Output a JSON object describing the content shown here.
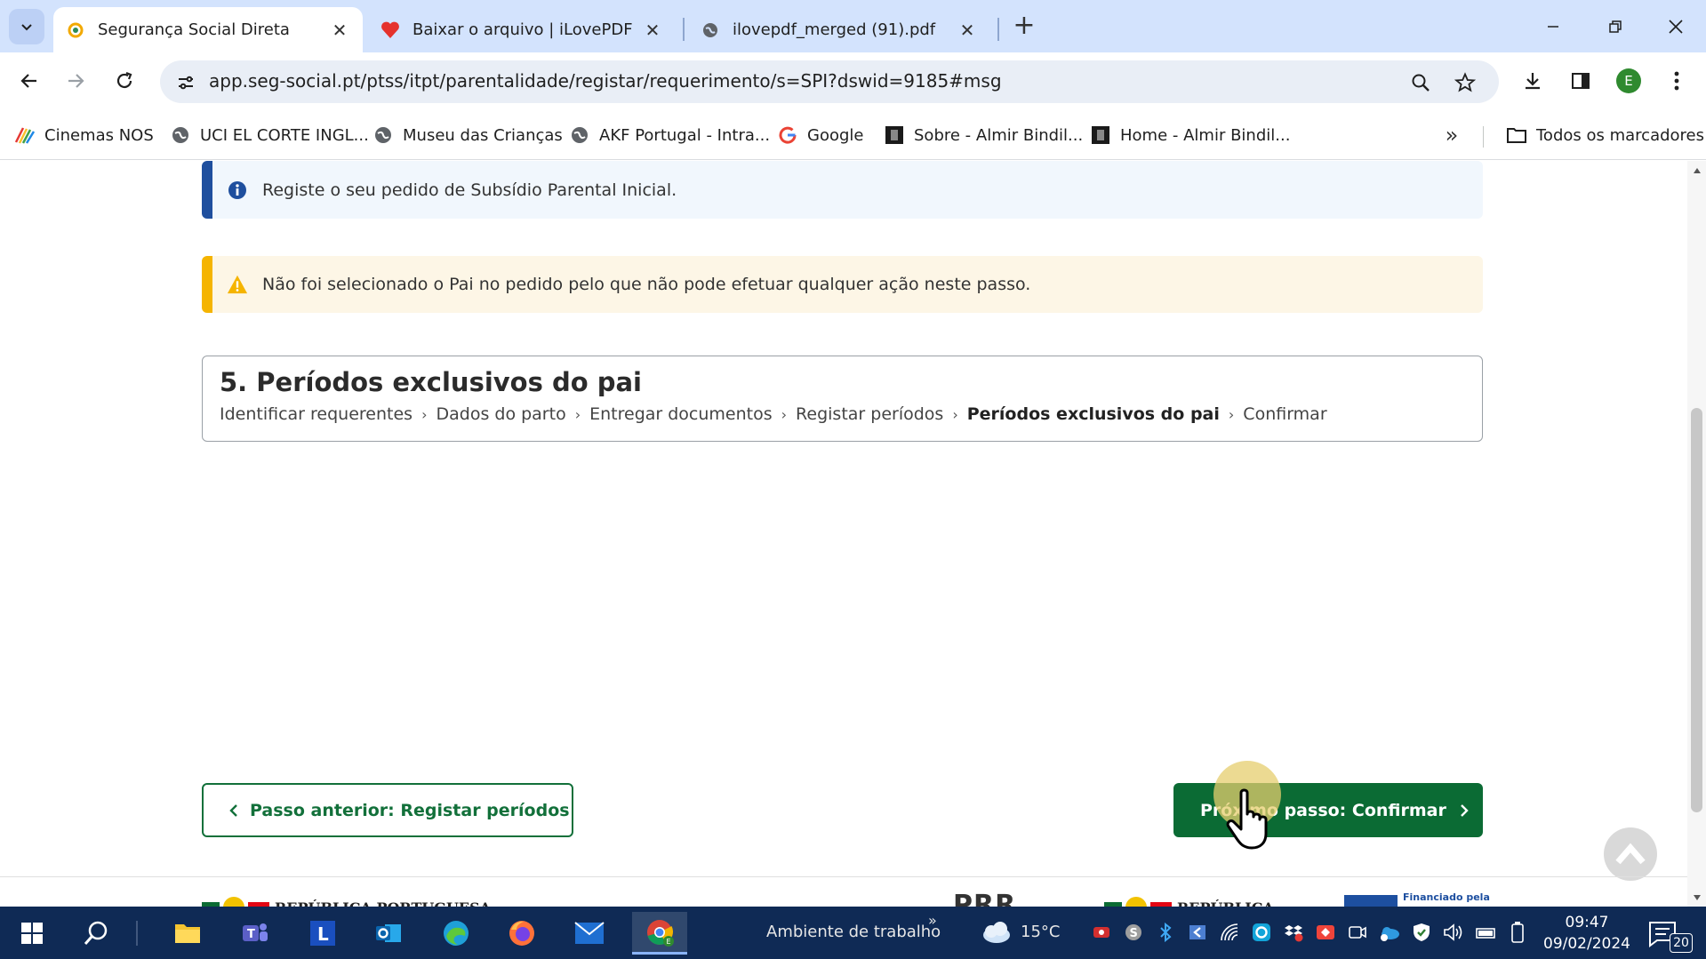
{
  "browser": {
    "tabs": [
      {
        "title": "Segurança Social Direta",
        "active": true,
        "icon": "seg-social-favicon"
      },
      {
        "title": "Baixar o arquivo | iLovePDF",
        "active": false,
        "icon": "ilovepdf-heart-icon"
      },
      {
        "title": "ilovepdf_merged (91).pdf",
        "active": false,
        "icon": "globe-icon"
      }
    ],
    "url": "app.seg-social.pt/ptss/itpt/parentalidade/registar/requerimento/s=SPI?dswid=9185#msg",
    "profile_initial": "E",
    "accent_color": "#d3e3fd"
  },
  "bookmarks": {
    "items": [
      {
        "label": "Cinemas NOS",
        "icon": "nos-icon"
      },
      {
        "label": "UCI EL CORTE INGL...",
        "icon": "globe-icon"
      },
      {
        "label": "Museu das Crianças",
        "icon": "globe-icon"
      },
      {
        "label": "AKF Portugal - Intra...",
        "icon": "globe-icon"
      },
      {
        "label": "Google",
        "icon": "google-icon"
      },
      {
        "label": "Sobre - Almir Bindil...",
        "icon": "site-icon"
      },
      {
        "label": "Home - Almir Bindil...",
        "icon": "site-icon"
      }
    ],
    "all_label": "Todos os marcadores"
  },
  "page": {
    "info_alert": "Registe o seu pedido de Subsídio Parental Inicial.",
    "warning_alert": "Não foi selecionado o Pai no pedido pelo que não pode efetuar qualquer ação neste passo.",
    "step_title": "5. Períodos exclusivos do pai",
    "breadcrumb": [
      "Identificar requerentes",
      "Dados do parto",
      "Entregar documentos",
      "Registar períodos",
      "Períodos exclusivos do pai",
      "Confirmar"
    ],
    "current_step_index": 4,
    "prev_button": "Passo anterior: Registar períodos",
    "next_button": "Próximo passo: Confirmar",
    "footer_left": "REPÚBLICA PORTUGUESA",
    "footer_prr": "PRR",
    "footer_right": "REPÚBLICA",
    "footer_eu": "Financiado pela",
    "colors": {
      "primary_green": "#0b6b34",
      "info_border": "#1f4f9e",
      "warning_border": "#f5b400"
    }
  },
  "taskbar": {
    "desktop_label": "Ambiente de trabalho",
    "weather": "15°C",
    "time": "09:47",
    "date": "09/02/2024",
    "notification_count": "20"
  }
}
